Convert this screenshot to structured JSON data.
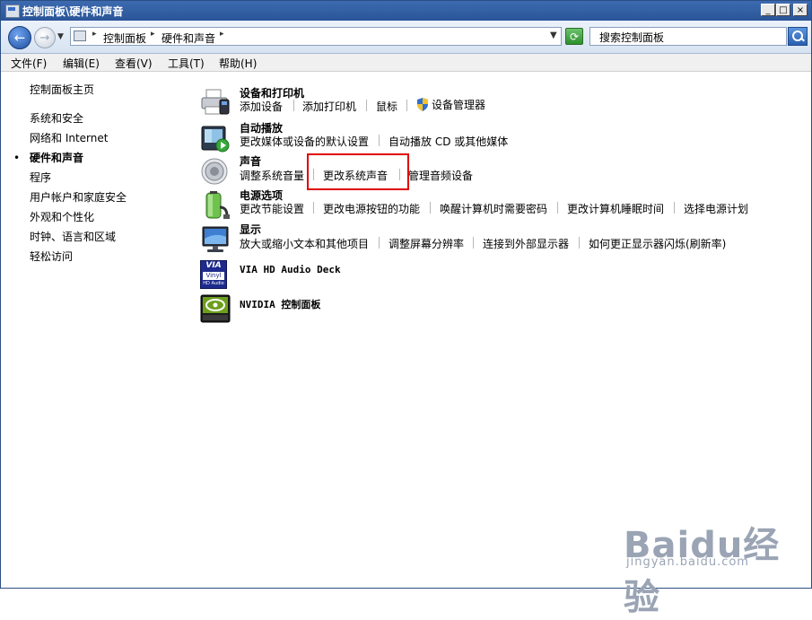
{
  "window": {
    "title": "控制面板\\硬件和声音",
    "controls": {
      "minimize": "_",
      "maximize": "□",
      "close": "×"
    }
  },
  "navigation": {
    "breadcrumbs": [
      "控制面板",
      "硬件和声音"
    ],
    "search_placeholder": "搜索控制面板"
  },
  "menu": [
    "文件(F)",
    "编辑(E)",
    "查看(V)",
    "工具(T)",
    "帮助(H)"
  ],
  "sidebar": {
    "home": "控制面板主页",
    "items": [
      {
        "label": "系统和安全",
        "current": false
      },
      {
        "label": "网络和 Internet",
        "current": false
      },
      {
        "label": "硬件和声音",
        "current": true
      },
      {
        "label": "程序",
        "current": false
      },
      {
        "label": "用户帐户和家庭安全",
        "current": false
      },
      {
        "label": "外观和个性化",
        "current": false
      },
      {
        "label": "时钟、语言和区域",
        "current": false
      },
      {
        "label": "轻松访问",
        "current": false
      }
    ],
    "bullet": "•"
  },
  "categories": {
    "devices": {
      "title": "设备和打印机",
      "icon": "printer-icon",
      "links": [
        "添加设备",
        "添加打印机",
        "鼠标",
        "设备管理器"
      ]
    },
    "autoplay": {
      "title": "自动播放",
      "icon": "autoplay-icon",
      "links": [
        "更改媒体或设备的默认设置",
        "自动播放 CD 或其他媒体"
      ]
    },
    "sound": {
      "title": "声音",
      "icon": "speaker-icon",
      "links": [
        "调整系统音量",
        "更改系统声音",
        "管理音频设备"
      ]
    },
    "power": {
      "title": "电源选项",
      "icon": "battery-icon",
      "links": [
        "更改节能设置",
        "更改电源按钮的功能",
        "唤醒计算机时需要密码",
        "更改计算机睡眠时间",
        "选择电源计划"
      ]
    },
    "display": {
      "title": "显示",
      "icon": "monitor-icon",
      "links": [
        "放大或缩小文本和其他项目",
        "调整屏幕分辨率",
        "连接到外部显示器",
        "如何更正显示器闪烁(刷新率)"
      ]
    },
    "via": {
      "title": "VIA HD Audio Deck",
      "icon": "via-vinyl-icon",
      "logo_text": [
        "VIA",
        "Vinyl",
        "HD Audio"
      ]
    },
    "nvidia": {
      "title": "NVIDIA 控制面板",
      "icon": "nvidia-icon"
    }
  },
  "watermark": {
    "text": "Baidu经验",
    "sub": "jingyan.baidu.com"
  }
}
